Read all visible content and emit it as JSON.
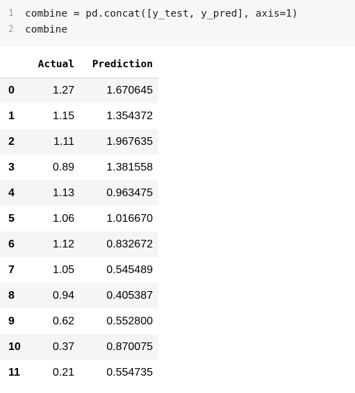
{
  "code": {
    "lines": [
      {
        "number": "1",
        "text": "combine = pd.concat([y_test, y_pred], axis=1)"
      },
      {
        "number": "2",
        "text": "combine"
      }
    ]
  },
  "table": {
    "columns": [
      "",
      "Actual",
      "Prediction"
    ],
    "rows": [
      {
        "index": "0",
        "actual": "1.27",
        "prediction": "1.670645"
      },
      {
        "index": "1",
        "actual": "1.15",
        "prediction": "1.354372"
      },
      {
        "index": "2",
        "actual": "1.11",
        "prediction": "1.967635"
      },
      {
        "index": "3",
        "actual": "0.89",
        "prediction": "1.381558"
      },
      {
        "index": "4",
        "actual": "1.13",
        "prediction": "0.963475"
      },
      {
        "index": "5",
        "actual": "1.06",
        "prediction": "1.016670"
      },
      {
        "index": "6",
        "actual": "1.12",
        "prediction": "0.832672"
      },
      {
        "index": "7",
        "actual": "1.05",
        "prediction": "0.545489"
      },
      {
        "index": "8",
        "actual": "0.94",
        "prediction": "0.405387"
      },
      {
        "index": "9",
        "actual": "0.62",
        "prediction": "0.552800"
      },
      {
        "index": "10",
        "actual": "0.37",
        "prediction": "0.870075"
      },
      {
        "index": "11",
        "actual": "0.21",
        "prediction": "0.554735"
      }
    ]
  }
}
